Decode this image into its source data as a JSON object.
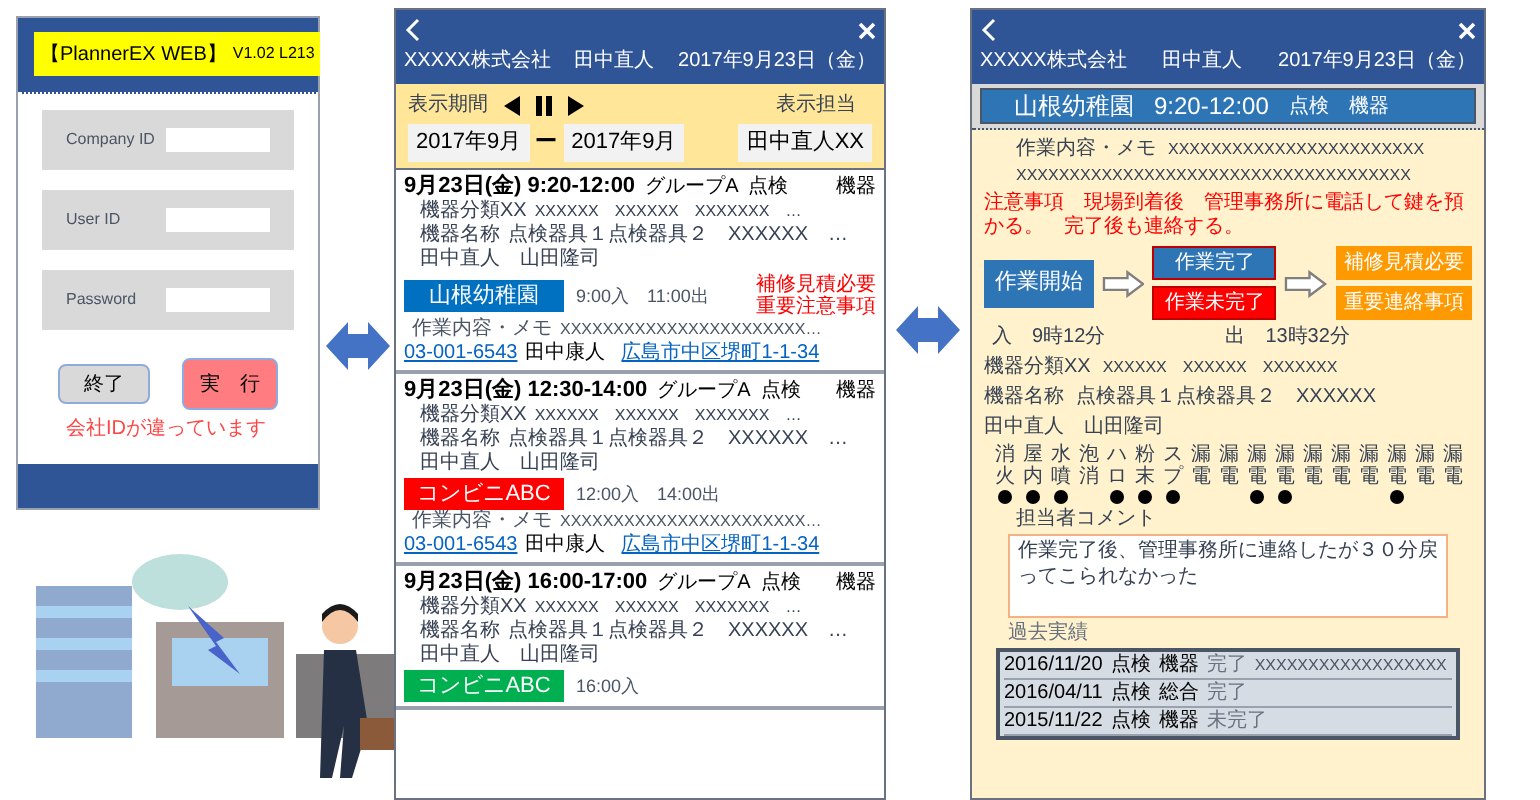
{
  "login_screen": {
    "app_title": "【PlannerEX WEB】",
    "version": "V1.02 L213",
    "fields": [
      {
        "label": "Company ID"
      },
      {
        "label": "User ID"
      },
      {
        "label": "Password"
      }
    ],
    "buttons": [
      {
        "label": "終了",
        "kind": "secondary"
      },
      {
        "label": "実　行",
        "kind": "primary"
      }
    ],
    "error": "会社IDが違っています"
  },
  "schedule_screen": {
    "header": {
      "company": "XXXXX株式会社",
      "user": "田中直人",
      "date": "2017年9月23日（金）"
    },
    "filter": {
      "period_label": "表示期間",
      "staff_label": "表示担当",
      "period_from": "2017年9月",
      "separator": "ー",
      "period_to": "2017年9月",
      "staff": "田中直人XX"
    },
    "jobs": [
      {
        "datetime": "9月23日(金) 9:20-12:00",
        "group": "グループA",
        "type": "点検",
        "category": "機器",
        "classification_label": "機器分類XX",
        "classification": "XXXXXX　XXXXXX　XXXXXXX　…",
        "equipment_label": "機器名称",
        "equipment": "点検器具１点検器具２　XXXXXX　…",
        "staff": "田中直人　山田隆司",
        "site": "山根幼稚園",
        "color": "#0070c0",
        "times": "9:00入　11:00出",
        "alerts": [
          "補修見積必要",
          "重要注意事項"
        ],
        "memo_label": "作業内容・メモ",
        "memo": "XXXXXXXXXXXXXXXXXXXXXXX…",
        "phone": "03-001-6543",
        "contact": "田中康人",
        "address": "広島市中区堺町1-1-34"
      },
      {
        "datetime": "9月23日(金) 12:30-14:00",
        "group": "グループA",
        "type": "点検",
        "category": "機器",
        "classification_label": "機器分類XX",
        "classification": "XXXXXX　XXXXXX　XXXXXXX　…",
        "equipment_label": "機器名称",
        "equipment": "点検器具１点検器具２　XXXXXX　…",
        "staff": "田中直人　山田隆司",
        "site": "コンビニABC",
        "color": "#ff0000",
        "times": "12:00入　14:00出",
        "memo_label": "作業内容・メモ",
        "memo": "XXXXXXXXXXXXXXXXXXXXXXX…",
        "phone": "03-001-6543",
        "contact": "田中康人",
        "address": "広島市中区堺町1-1-34"
      },
      {
        "datetime": "9月23日(金) 16:00-17:00",
        "group": "グループA",
        "type": "点検",
        "category": "機器",
        "classification_label": "機器分類XX",
        "classification": "XXXXXX　XXXXXX　XXXXXXX　…",
        "equipment_label": "機器名称",
        "equipment": "点検器具１点検器具２　XXXXXX　…",
        "staff": "田中直人　山田隆司",
        "site": "コンビニABC",
        "color": "#00b050",
        "times": "16:00入"
      }
    ]
  },
  "detail_screen": {
    "header": {
      "company": "XXXXX株式会社",
      "user": "田中直人",
      "date": "2017年9月23日（金）"
    },
    "job": {
      "site": "山根幼稚園",
      "time": "9:20-12:00",
      "type": "点検",
      "category": "機器"
    },
    "memo_label": "作業内容・メモ",
    "memo_lines": [
      "XXXXXXXXXXXXXXXXXXXXXXXX",
      "XXXXXXXXXXXXXXXXXXXXXXXXXXXXXXXXXXXXX"
    ],
    "notice": "注意事項　現場到着後　管理事務所に電話して鍵を預かる。　完了後も連絡する。",
    "actions": {
      "start": "作業開始",
      "results": [
        {
          "label": "作業完了",
          "color": "#2e75b6"
        },
        {
          "label": "作業未完了",
          "color": "#ff0000"
        }
      ],
      "follow_ups": [
        "補修見積必要",
        "重要連絡事項"
      ]
    },
    "check_in": "入　9時12分",
    "check_out": "出　13時32分",
    "classification_label": "機器分類XX",
    "classification": "XXXXXX　XXXXXX　XXXXXXX",
    "equipment_label": "機器名称",
    "equipment": "点検器具１点検器具２　XXXXXX",
    "staff": "田中直人　山田隆司",
    "equipment_checks": [
      {
        "top": "消",
        "bottom": "火",
        "checked": true
      },
      {
        "top": "屋",
        "bottom": "内",
        "checked": true
      },
      {
        "top": "水",
        "bottom": "噴",
        "checked": true
      },
      {
        "top": "泡",
        "bottom": "消",
        "checked": false
      },
      {
        "top": "ハ",
        "bottom": "ロ",
        "checked": true
      },
      {
        "top": "粉",
        "bottom": "末",
        "checked": true
      },
      {
        "top": "ス",
        "bottom": "プ",
        "checked": true
      },
      {
        "top": "漏",
        "bottom": "電",
        "checked": false
      },
      {
        "top": "漏",
        "bottom": "電",
        "checked": false
      },
      {
        "top": "漏",
        "bottom": "電",
        "checked": true
      },
      {
        "top": "漏",
        "bottom": "電",
        "checked": true
      },
      {
        "top": "漏",
        "bottom": "電",
        "checked": false
      },
      {
        "top": "漏",
        "bottom": "電",
        "checked": false
      },
      {
        "top": "漏",
        "bottom": "電",
        "checked": false
      },
      {
        "top": "漏",
        "bottom": "電",
        "checked": true
      },
      {
        "top": "漏",
        "bottom": "電",
        "checked": false
      },
      {
        "top": "漏",
        "bottom": "電",
        "checked": false
      }
    ],
    "comment_label": "担当者コメント",
    "comment": "作業完了後、管理事務所に連絡したが３０分戻ってこられなかった",
    "history_label": "過去実績",
    "history": [
      {
        "date": "2016/11/20",
        "type": "点検",
        "category": "機器",
        "status": "完了",
        "note": "XXXXXXXXXXXXXXXXXX"
      },
      {
        "date": "2016/04/11",
        "type": "点検",
        "category": "総合",
        "status": "完了"
      },
      {
        "date": "2015/11/22",
        "type": "点検",
        "category": "機器",
        "status": "未完了"
      }
    ]
  }
}
